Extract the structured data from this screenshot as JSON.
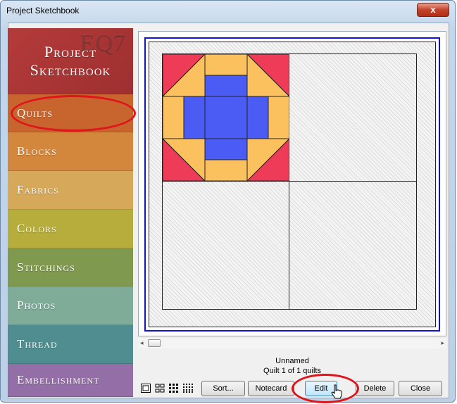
{
  "window": {
    "title": "Project Sketchbook",
    "close_glyph": "x"
  },
  "sidebar": {
    "header_line1": "Project",
    "header_line2": "Sketchbook",
    "watermark": "EQ7",
    "tabs": [
      {
        "label": "Quilts",
        "color": "#c8652f"
      },
      {
        "label": "Blocks",
        "color": "#d2873c"
      },
      {
        "label": "Fabrics",
        "color": "#d5a85a"
      },
      {
        "label": "Colors",
        "color": "#b6ad3c"
      },
      {
        "label": "Stitchings",
        "color": "#7f9a4e"
      },
      {
        "label": "Photos",
        "color": "#7fab99"
      },
      {
        "label": "Thread",
        "color": "#4f8d90"
      },
      {
        "label": "Embellishment",
        "color": "#946ea6"
      }
    ]
  },
  "preview": {
    "block_colors": {
      "red": "#ee3b57",
      "gold": "#fcc15f",
      "blue": "#4a5cf4"
    }
  },
  "status": {
    "name": "Unnamed",
    "count": "Quilt 1 of 1 quilts"
  },
  "toolbar": {
    "sort": "Sort...",
    "notecard": "Notecard",
    "edit": "Edit",
    "delete": "Delete",
    "close": "Close"
  },
  "colors": {
    "highlight": "#e0141a",
    "frame": "#1010e0"
  }
}
